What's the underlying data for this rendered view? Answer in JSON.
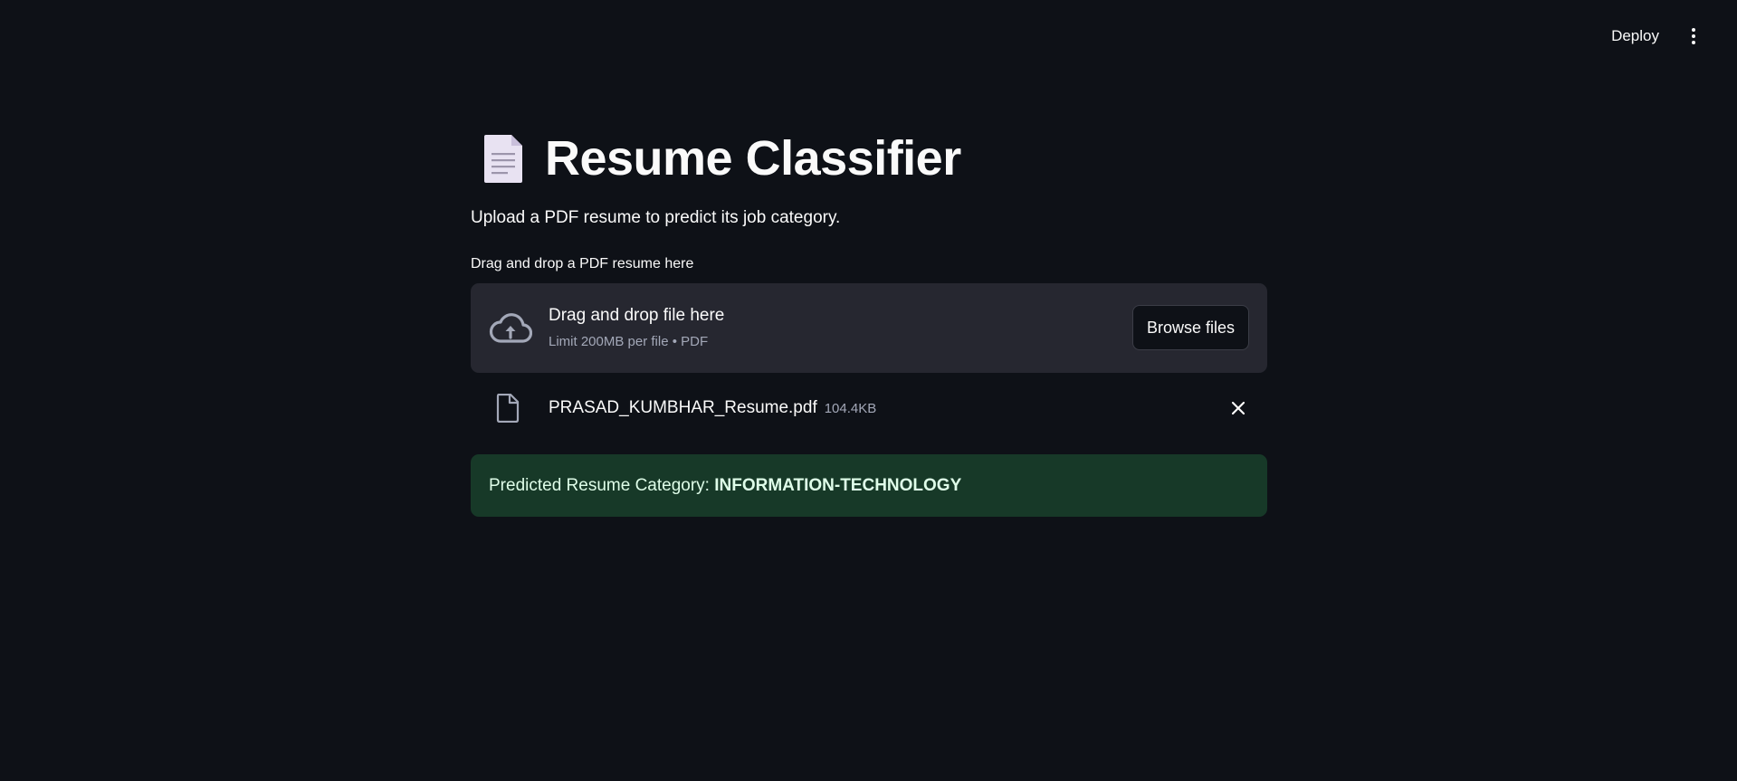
{
  "header": {
    "deploy_label": "Deploy",
    "menu_icon": "vertical-ellipsis-icon"
  },
  "page": {
    "title": "Resume Classifier",
    "title_icon": "page-document-icon",
    "subtitle": "Upload a PDF resume to predict its job category."
  },
  "uploader": {
    "label": "Drag and drop a PDF resume here",
    "dropzone_title": "Drag and drop file here",
    "dropzone_limit": "Limit 200MB per file • PDF",
    "browse_label": "Browse files",
    "icon": "cloud-upload-icon"
  },
  "uploaded_file": {
    "name": "PRASAD_KUMBHAR_Resume.pdf",
    "size": "104.4KB",
    "icon": "file-icon",
    "remove_icon": "close-icon"
  },
  "result": {
    "prefix": "Predicted Resume Category: ",
    "category": "INFORMATION-TECHNOLOGY",
    "bg_color": "#173928",
    "text_color": "#dffde9"
  },
  "colors": {
    "background": "#0e1117",
    "panel": "#262730",
    "text": "#fafafa",
    "muted": "#a3a8b8"
  }
}
